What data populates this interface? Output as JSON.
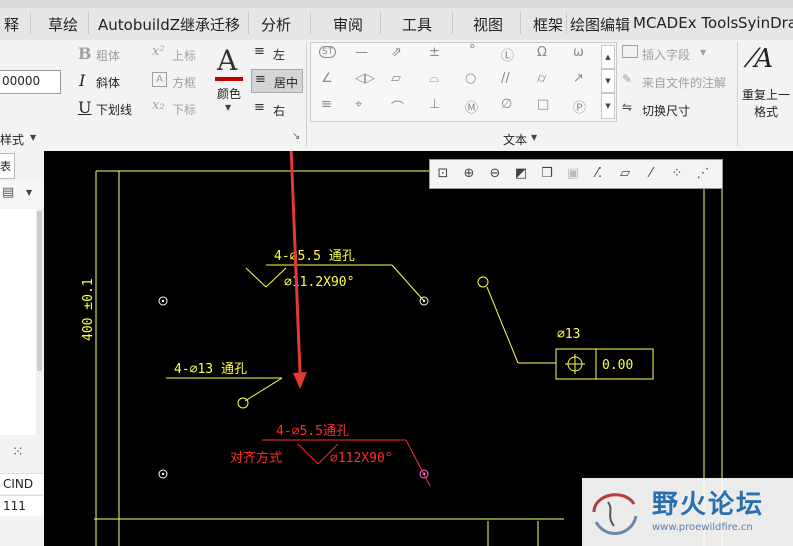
{
  "tabs": [
    "释",
    "草绘",
    "AutobuildZ继承迁移",
    "分析",
    "审阅",
    "工具",
    "视图",
    "框架",
    "绘图编辑",
    "MCADEx Tools",
    "SyinDra"
  ],
  "format": {
    "input_value": "00000",
    "bold": "粗体",
    "italic": "斜体",
    "underline": "下划线",
    "superscript": "上标",
    "square": "方框",
    "subscript": "下标",
    "color": "颜色",
    "align_left": "左",
    "align_center": "居中",
    "align_right": "右",
    "group_label": "样式"
  },
  "text_group": {
    "insert_field": "插入字段",
    "from_file_note": "来自文件的注解",
    "toggle_dimension": "切换尺寸",
    "group_label": "文本",
    "repeat_last_1": "重复上一",
    "repeat_last_2": "格式"
  },
  "left_panel": {
    "tab_label": "表",
    "label_cind": "CIND",
    "value_111": "111"
  },
  "drawing": {
    "note1_top": "4-∅5.5 通孔",
    "note1_bottom": "∅11.2X90°",
    "dim_vertical": "400 ±0.1",
    "note2": "4-∅13 通孔",
    "gtol_dia": "∅13",
    "gtol_value": "0.00",
    "note3_top": "4-∅5.5通孔",
    "note3_left": "对齐方式",
    "note3_bottom": "∅112X90°"
  },
  "watermark": {
    "title": "野火论坛",
    "url": "www.proewildfire.cn"
  },
  "colors": {
    "canvas_bg": "#000000",
    "drawing_line": "#ffff00",
    "arrow": "#e53935",
    "selected_red": "#ff2a2a",
    "color_swatch": "#c00000"
  }
}
